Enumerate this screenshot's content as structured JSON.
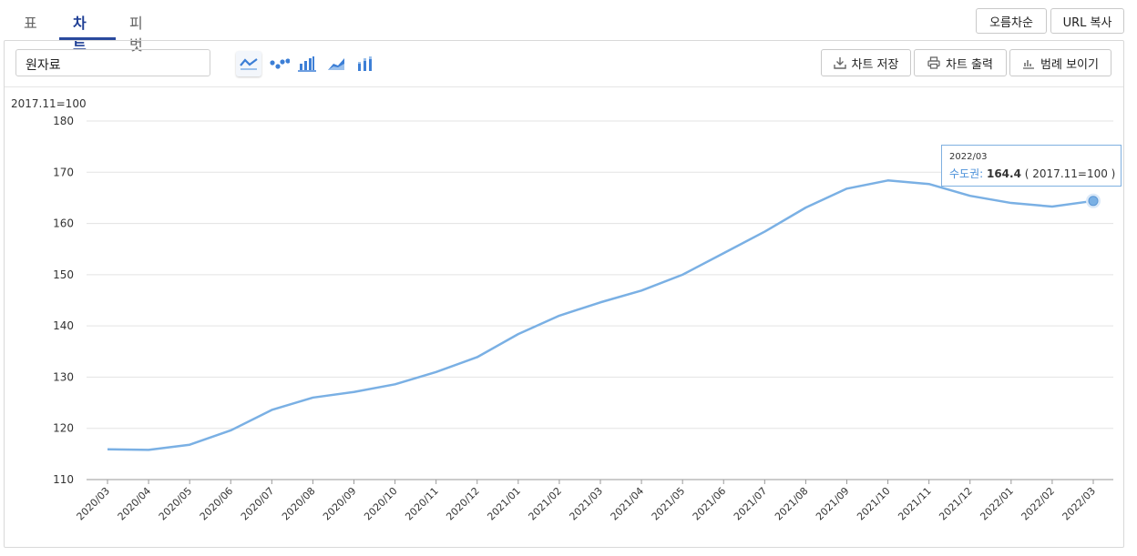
{
  "tabs": [
    {
      "label": "표"
    },
    {
      "label": "차트"
    },
    {
      "label": "피벗"
    }
  ],
  "top_buttons": {
    "sort_label": "오름차순",
    "url_copy_label": "URL 복사"
  },
  "toolbar": {
    "indicator_value": "원자료",
    "save_label": "차트 저장",
    "print_label": "차트 출력",
    "legend_label": "범례 보이기"
  },
  "chart_type_icons": [
    "line-chart-icon",
    "scatter-chart-icon",
    "bar-chart-icon",
    "area-chart-icon",
    "stacked-bar-chart-icon"
  ],
  "colors": {
    "series": "#7ab0e4",
    "tab_active": "#1f3f95",
    "accent": "#2a4a9e"
  },
  "tooltip": {
    "date": "2022/03",
    "series_name": "수도권",
    "value": "164.4",
    "unit": "( 2017.11=100 )"
  },
  "chart_data": {
    "type": "line",
    "unit_label": "2017.11=100",
    "ylim": [
      110,
      180
    ],
    "yticks": [
      110,
      120,
      130,
      140,
      150,
      160,
      170,
      180
    ],
    "grid": true,
    "categories": [
      "2020/03",
      "2020/04",
      "2020/05",
      "2020/06",
      "2020/07",
      "2020/08",
      "2020/09",
      "2020/10",
      "2020/11",
      "2020/12",
      "2021/01",
      "2021/02",
      "2021/03",
      "2021/04",
      "2021/05",
      "2021/06",
      "2021/07",
      "2021/08",
      "2021/09",
      "2021/10",
      "2021/11",
      "2021/12",
      "2022/01",
      "2022/02",
      "2022/03"
    ],
    "series": [
      {
        "name": "수도권",
        "values": [
          115.9,
          115.8,
          116.8,
          119.6,
          123.6,
          126.0,
          127.1,
          128.6,
          131.0,
          133.9,
          138.4,
          142.0,
          144.6,
          146.9,
          150.0,
          154.2,
          158.4,
          163.1,
          166.8,
          168.4,
          167.7,
          165.4,
          164.0,
          163.3,
          164.4
        ]
      }
    ],
    "highlight_index": 24
  }
}
